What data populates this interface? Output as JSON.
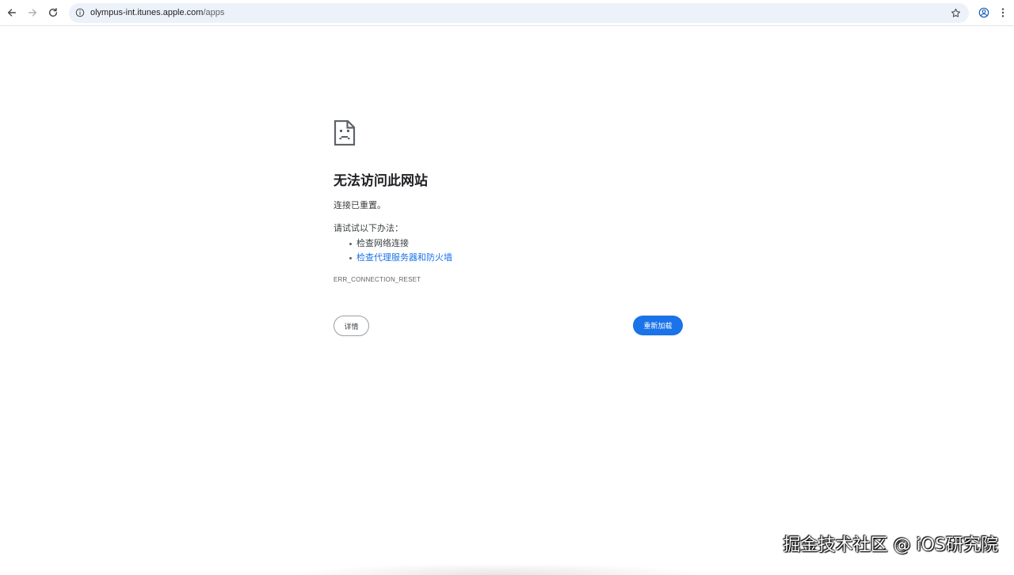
{
  "browser": {
    "url_host": "olympus-int.itunes.apple.com",
    "url_path": "/apps",
    "icons": {
      "back": "arrow-left-icon",
      "forward": "arrow-right-icon",
      "reload": "reload-icon",
      "site_info": "info-icon",
      "bookmark": "star-icon",
      "profile": "profile-icon",
      "menu": "kebab-menu-icon"
    }
  },
  "error": {
    "icon": "sad-document-icon",
    "title": "无法访问此网站",
    "description": "连接已重置。",
    "suggest_header": "请试试以下办法：",
    "suggestions": [
      {
        "text": "检查网络连接",
        "link": false
      },
      {
        "text": "检查代理服务器和防火墙",
        "link": true
      }
    ],
    "code": "ERR_CONNECTION_RESET",
    "details_label": "详情",
    "reload_label": "重新加载"
  },
  "watermark": "掘金技术社区 @ iOS研究院",
  "colors": {
    "accent": "#1a73e8",
    "omnibox_bg": "#edf1f9",
    "text": "#202124"
  }
}
